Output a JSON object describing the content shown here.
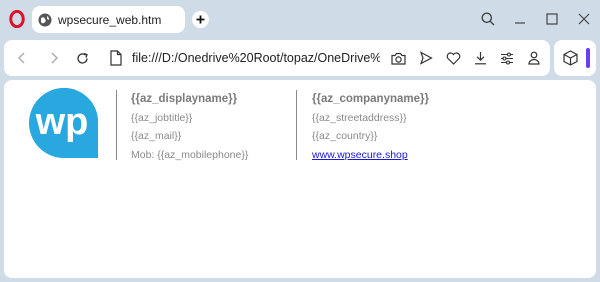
{
  "window": {
    "tab_title": "wpsecure_web.htm"
  },
  "toolbar": {
    "url": "file:///D:/Onedrive%20Root/topaz/OneDrive%2"
  },
  "signature": {
    "logo_text": "wp",
    "display_name": "{{az_displayname}}",
    "job_title": "{{az_jobtitle}}",
    "mail": "{{az_mail}}",
    "mobile": "Mob: {{az_mobilephone}}",
    "company_name": "{{az_companyname}}",
    "street_address": "{{az_streetaddress}}",
    "country": "{{az_country}}",
    "website": "www.wpsecure.shop"
  },
  "colors": {
    "accent": "#6b3cf0",
    "logo": "#29a8e0",
    "link": "#1a1ad6"
  }
}
